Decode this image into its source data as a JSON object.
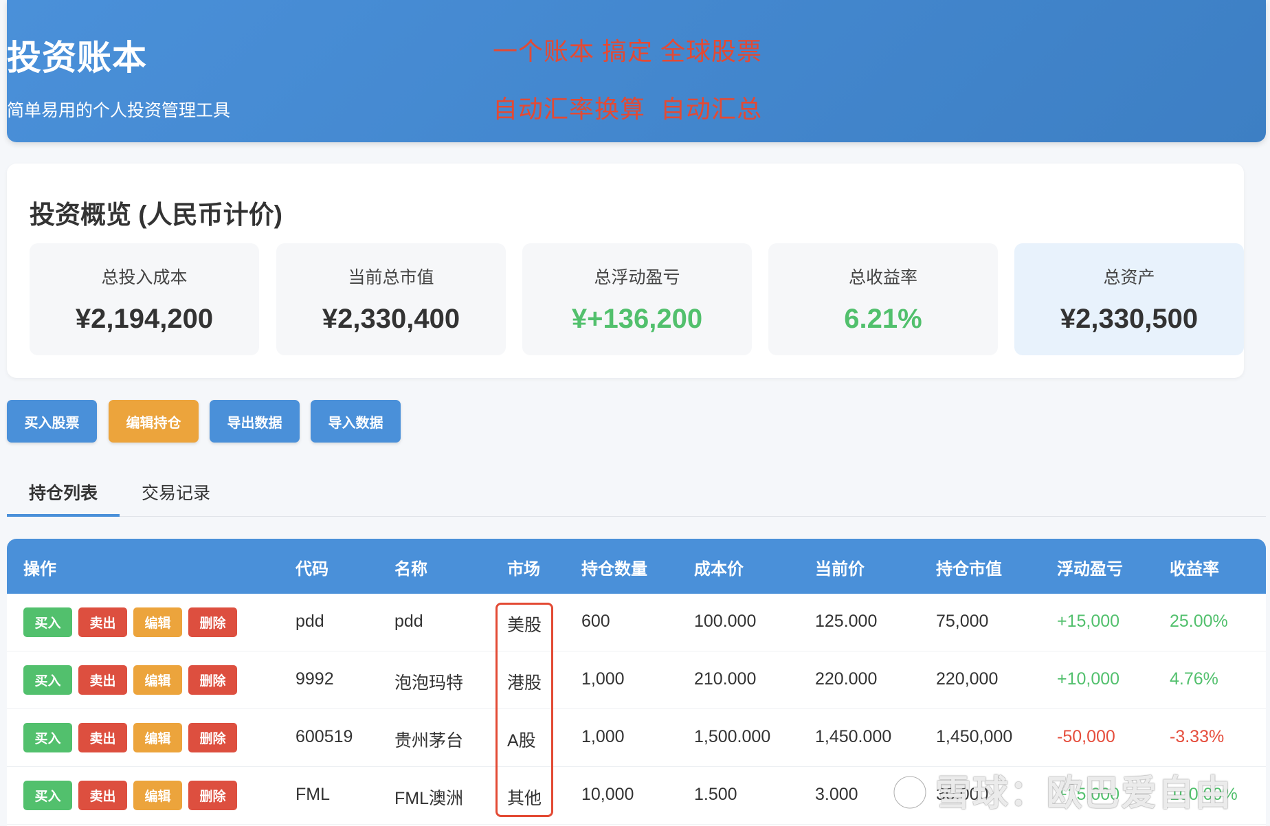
{
  "header": {
    "title": "投资账本",
    "subtitle": "简单易用的个人投资管理工具",
    "slogan_line1": "一个账本 搞定 全球股票",
    "slogan_line2": "自动汇率换算  自动汇总"
  },
  "overview": {
    "title": "投资概览 (人民币计价)",
    "stats": [
      {
        "label": "总投入成本",
        "value": "¥2,194,200"
      },
      {
        "label": "当前总市值",
        "value": "¥2,330,400"
      },
      {
        "label": "总浮动盈亏",
        "value": "¥+136,200"
      },
      {
        "label": "总收益率",
        "value": "6.21%"
      },
      {
        "label": "总资产",
        "value": "¥2,330,500"
      }
    ]
  },
  "actions": {
    "buy": "买入股票",
    "edit": "编辑持仓",
    "export": "导出数据",
    "import": "导入数据"
  },
  "tabs": [
    {
      "label": "持仓列表",
      "active": true
    },
    {
      "label": "交易记录",
      "active": false
    }
  ],
  "table": {
    "headers": [
      "操作",
      "代码",
      "名称",
      "市场",
      "持仓数量",
      "成本价",
      "当前价",
      "持仓市值",
      "浮动盈亏",
      "收益率"
    ],
    "row_actions": {
      "buy": "买入",
      "sell": "卖出",
      "edit": "编辑",
      "delete": "删除"
    },
    "rows": [
      {
        "code": "pdd",
        "name": "pdd",
        "market": "美股",
        "qty": "600",
        "cost": "100.000",
        "price": "125.000",
        "value": "75,000",
        "pnl": "+15,000",
        "rate": "25.00%"
      },
      {
        "code": "9992",
        "name": "泡泡玛特",
        "market": "港股",
        "qty": "1,000",
        "cost": "210.000",
        "price": "220.000",
        "value": "220,000",
        "pnl": "+10,000",
        "rate": "4.76%"
      },
      {
        "code": "600519",
        "name": "贵州茅台",
        "market": "A股",
        "qty": "1,000",
        "cost": "1,500.000",
        "price": "1,450.000",
        "value": "1,450,000",
        "pnl": "-50,000",
        "rate": "-3.33%"
      },
      {
        "code": "FML",
        "name": "FML澳洲",
        "market": "其他",
        "qty": "10,000",
        "cost": "1.500",
        "price": "3.000",
        "value": "30,000",
        "pnl": "+15,000",
        "rate": "100.00%"
      }
    ]
  },
  "watermark": "雪球：欧巴爱自由",
  "colors": {
    "primary": "#4a90d9",
    "orange": "#eca43c",
    "positive": "#52c06d",
    "negative": "#e54d3c",
    "annotation_red": "#e34a34"
  }
}
